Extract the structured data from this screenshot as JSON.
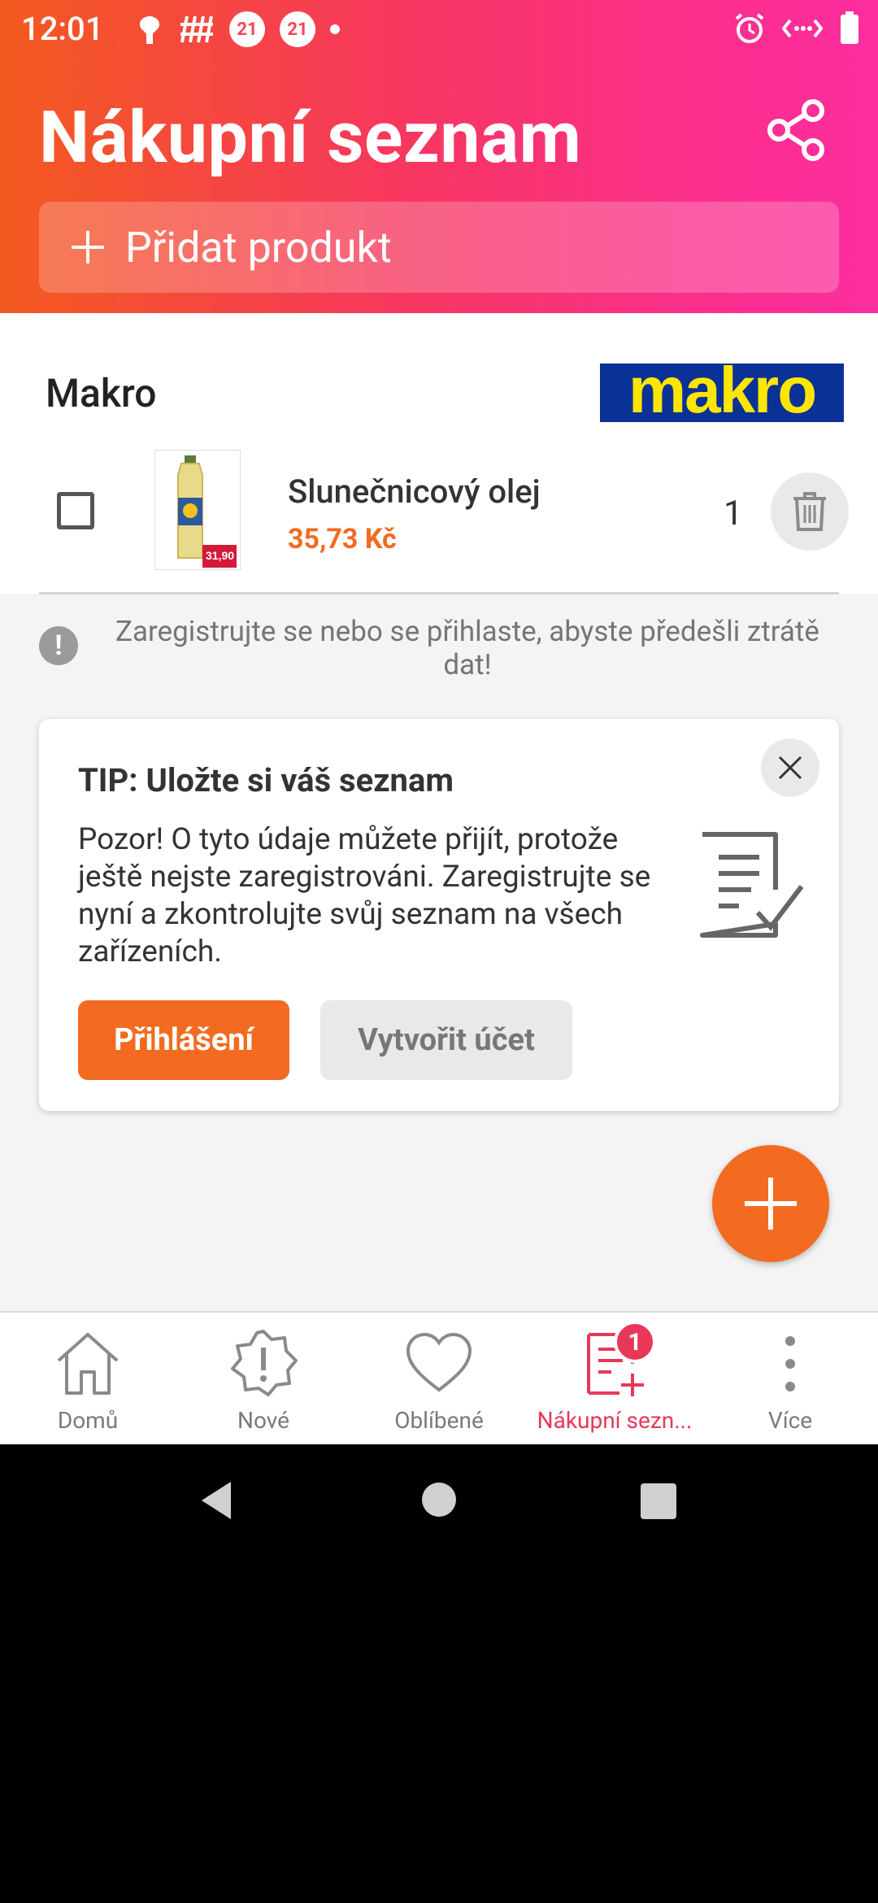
{
  "status_bar": {
    "time": "12:01",
    "notif_badge_a": "21",
    "notif_badge_b": "21"
  },
  "header": {
    "title": "Nákupní seznam",
    "add_product_label": "Přidat produkt"
  },
  "store": {
    "name": "Makro",
    "logo_text": "makro",
    "items": [
      {
        "name": "Slunečnicový olej",
        "price": "35,73 Kč",
        "quantity": "1",
        "image_price_tag": "31,90"
      }
    ]
  },
  "notice": {
    "text": "Zaregistrujte se nebo se přihlaste, abyste předešli ztrátě dat!"
  },
  "tip": {
    "title": "TIP: Uložte si váš seznam",
    "body": "Pozor! O tyto údaje můžete přijít, protože ještě nejste zaregistrováni. Zaregistrujte se nyní a zkontrolujte svůj seznam na všech zařízeních.",
    "login_label": "Přihlášení",
    "create_label": "Vytvořit účet"
  },
  "bottom_nav": {
    "items": [
      {
        "label": "Domů",
        "icon": "home-icon"
      },
      {
        "label": "Nové",
        "icon": "new-badge-icon"
      },
      {
        "label": "Oblíbené",
        "icon": "heart-icon"
      },
      {
        "label": "Nákupní sezn...",
        "icon": "shopping-list-icon",
        "badge": "1"
      },
      {
        "label": "Více",
        "icon": "more-vertical-icon"
      }
    ]
  },
  "colors": {
    "accent_orange": "#f26b21",
    "accent_pink": "#e8385a",
    "makro_blue": "#0a3196",
    "makro_yellow": "#ffe600"
  }
}
